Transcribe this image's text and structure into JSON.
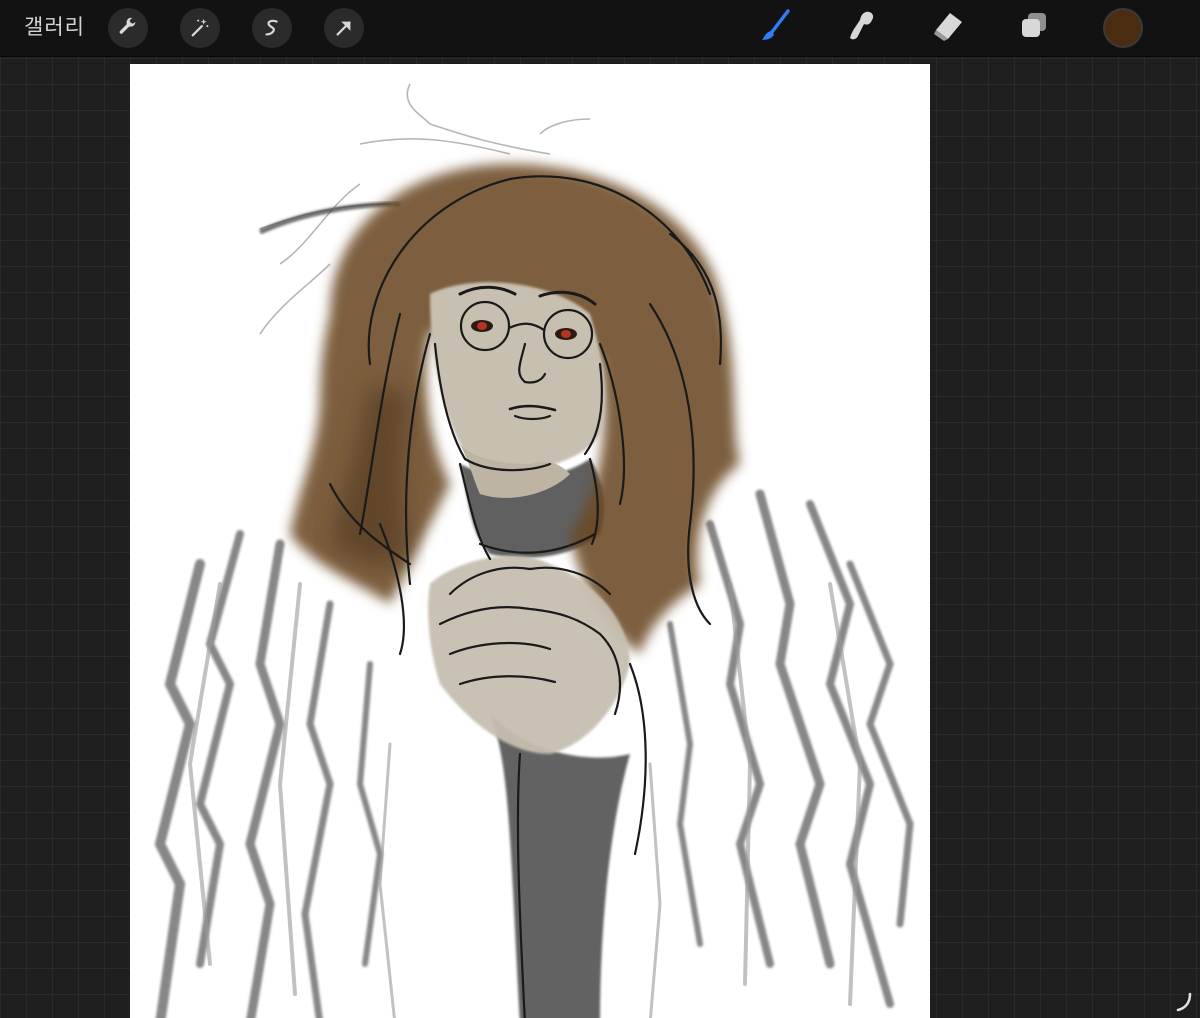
{
  "toolbar": {
    "gallery_label": "갤러리",
    "left_tools": [
      {
        "name": "wrench-icon",
        "label": "actions"
      },
      {
        "name": "magic-wand-icon",
        "label": "adjustments"
      },
      {
        "name": "selection-icon",
        "label": "selection"
      },
      {
        "name": "transform-arrow-icon",
        "label": "transform"
      }
    ],
    "right_tools": [
      {
        "name": "brush-icon",
        "active": true
      },
      {
        "name": "smudge-icon",
        "active": false
      },
      {
        "name": "eraser-icon",
        "active": false
      },
      {
        "name": "layers-icon",
        "active": false
      }
    ],
    "active_color": "#4a2c10",
    "accent_color": "#2f7cf6"
  },
  "canvas": {
    "background": "#ffffff",
    "hair_color": "#6b4a24",
    "skin_color": "#c7bfb0",
    "line_color": "#1a1a1a"
  }
}
